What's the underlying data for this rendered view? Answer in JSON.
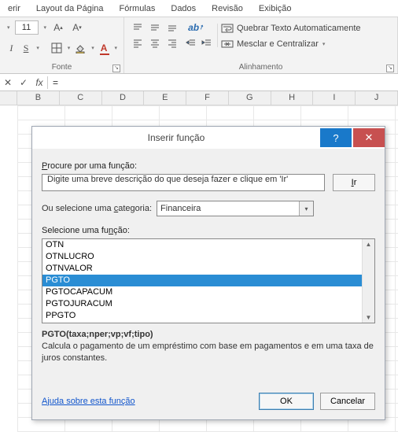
{
  "ribbon": {
    "tabs": [
      "erir",
      "Layout da Página",
      "Fórmulas",
      "Dados",
      "Revisão",
      "Exibição"
    ],
    "font_size": "11",
    "group_font": "Fonte",
    "group_align": "Alinhamento",
    "wrap_label": "Quebrar Texto Automaticamente",
    "merge_label": "Mesclar e Centralizar"
  },
  "formula_bar": {
    "cancel_icon": "✕",
    "enter_icon": "✓",
    "fx_icon": "fx",
    "value": "="
  },
  "columns": [
    "B",
    "C",
    "D",
    "E",
    "F",
    "G",
    "H",
    "I",
    "J"
  ],
  "dialog": {
    "title": "Inserir função",
    "help_glyph": "?",
    "close_glyph": "✕",
    "search_label_pre": "P",
    "search_label_post": "rocure por uma função:",
    "search_value": "Digite uma breve descrição do que deseja fazer e clique em 'Ir'",
    "go_pre": "I",
    "go_post": "r",
    "category_label_pre": "Ou selecione uma ",
    "category_label_u": "c",
    "category_label_post": "ategoria:",
    "category_value": "Financeira",
    "select_label_pre": "Selecione uma fu",
    "select_label_u": "n",
    "select_label_post": "ção:",
    "functions": [
      "OTN",
      "OTNLUCRO",
      "OTNVALOR",
      "PGTO",
      "PGTOCAPACUM",
      "PGTOJURACUM",
      "PPGTO"
    ],
    "selected_index": 3,
    "signature": "PGTO(taxa;nper;vp;vf;tipo)",
    "description": "Calcula o pagamento de um empréstimo com base em pagamentos e em uma taxa de juros constantes.",
    "help_link": "Ajuda sobre esta função",
    "ok": "OK",
    "cancel": "Cancelar"
  }
}
